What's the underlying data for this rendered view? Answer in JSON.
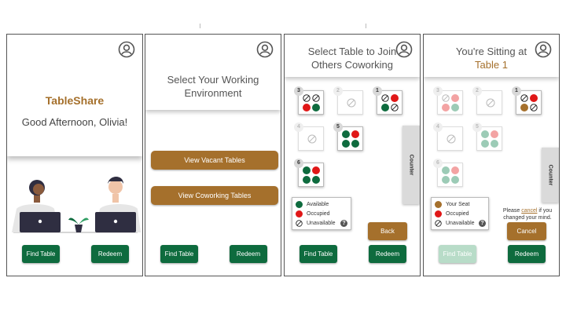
{
  "colors": {
    "green": "#0e6b3e",
    "red": "#e01717",
    "brown": "#a5702c",
    "faded_green": "#9ccbb6",
    "faded_red": "#f3a3a3"
  },
  "screen1": {
    "brand": "TableShare",
    "greeting": "Good Afternoon, Olivia!",
    "find_table": "Find Table",
    "redeem": "Redeem"
  },
  "screen2": {
    "title_line1": "Select Your Working",
    "title_line2": "Environment",
    "vacant": "View Vacant Tables",
    "coworking": "View Coworking Tables",
    "find_table": "Find Table",
    "redeem": "Redeem"
  },
  "screen3": {
    "title_line1": "Select Table to Join",
    "title_line2": "Others Coworking",
    "tables": [
      {
        "num": "3",
        "seats": [
          "na",
          "na",
          "red",
          "green"
        ]
      },
      {
        "num": "2",
        "seats": "unavailable"
      },
      {
        "num": "1",
        "seats": [
          "na",
          "red",
          "green",
          "na"
        ]
      },
      {
        "num": "4",
        "seats": "unavailable"
      },
      {
        "num": "5",
        "seats": [
          "green",
          "red",
          "green",
          "green"
        ]
      },
      {
        "num": "6",
        "seats": [
          "green",
          "red",
          "green",
          "green"
        ]
      }
    ],
    "counter": "Counter",
    "legend": {
      "available": "Available",
      "occupied": "Occupied",
      "unavailable": "Unavailable",
      "help": "?"
    },
    "back": "Back",
    "find_table": "Find Table",
    "redeem": "Redeem"
  },
  "screen4": {
    "title_line1": "You're Sitting at",
    "title_line2": "Table 1",
    "counter": "Counter",
    "legend": {
      "your_seat": "Your Seat",
      "occupied": "Occupied",
      "unavailable": "Unavailable",
      "help": "?"
    },
    "note_pre": "Please",
    "note_link": "cancel",
    "note_post": "if you",
    "note_line2": "changed your mind.",
    "cancel": "Cancel",
    "find_table": "Find Table",
    "redeem": "Redeem"
  }
}
